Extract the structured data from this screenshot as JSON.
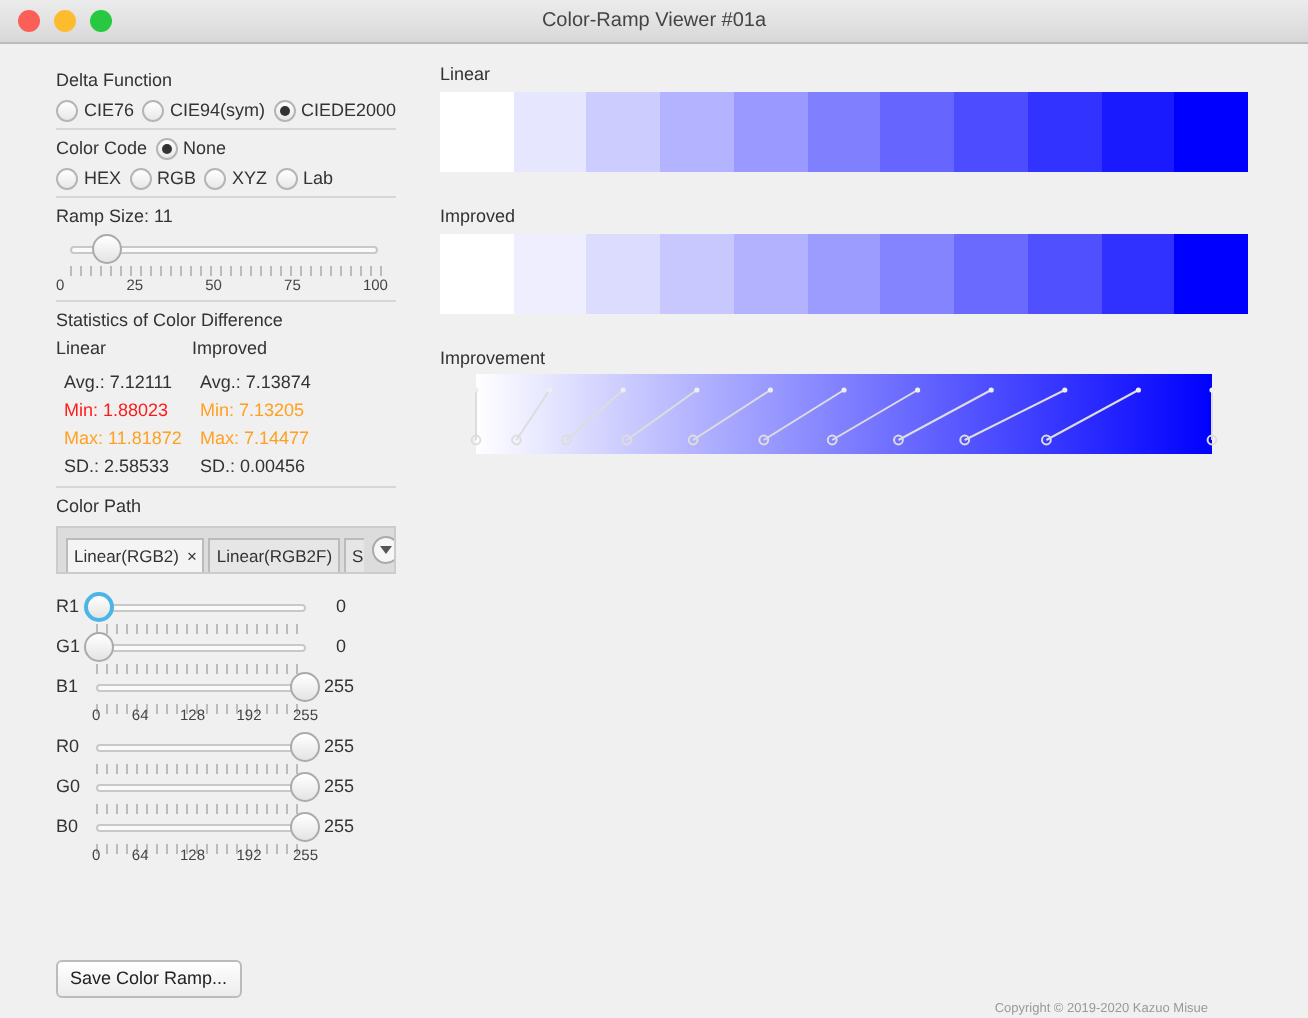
{
  "window": {
    "title": "Color-Ramp Viewer #01a"
  },
  "delta_function": {
    "label": "Delta Function",
    "options": [
      {
        "label": "CIE76",
        "selected": false
      },
      {
        "label": "CIE94(sym)",
        "selected": false
      },
      {
        "label": "CIEDE2000",
        "selected": true
      }
    ]
  },
  "color_code": {
    "label": "Color Code",
    "options": [
      {
        "label": "None",
        "selected": true
      },
      {
        "label": "HEX",
        "selected": false
      },
      {
        "label": "RGB",
        "selected": false
      },
      {
        "label": "XYZ",
        "selected": false
      },
      {
        "label": "Lab",
        "selected": false
      }
    ]
  },
  "ramp_size": {
    "label": "Ramp Size: 11",
    "level": 0.11,
    "scale": [
      "0",
      "25",
      "50",
      "75",
      "100"
    ]
  },
  "statistics": {
    "title": "Statistics of Color Difference",
    "columns": [
      {
        "heading": "Linear",
        "rows": [
          {
            "text": "Avg.: 7.12111",
            "color": "#333333"
          },
          {
            "text": "Min: 1.88023",
            "color": "#ff1a1a"
          },
          {
            "text": "Max: 11.81872",
            "color": "#ffa020"
          },
          {
            "text": "SD.: 2.58533",
            "color": "#333333"
          }
        ]
      },
      {
        "heading": "Improved",
        "rows": [
          {
            "text": "Avg.: 7.13874",
            "color": "#333333"
          },
          {
            "text": "Min: 7.13205",
            "color": "#ffa020"
          },
          {
            "text": "Max: 7.14477",
            "color": "#ffa020"
          },
          {
            "text": "SD.: 0.00456",
            "color": "#333333"
          }
        ]
      }
    ]
  },
  "color_path": {
    "label": "Color Path",
    "tabs": [
      {
        "label": "Linear(RGB2)",
        "closable": true,
        "close_mark": "×",
        "selected": true
      },
      {
        "label": "Linear(RGB2F)",
        "closable": false,
        "selected": false
      },
      {
        "label": "S",
        "closable": false,
        "selected": false
      }
    ],
    "sliders": [
      {
        "label": "R1",
        "level": 0,
        "reading": "0",
        "focused": true
      },
      {
        "label": "G1",
        "level": 0,
        "reading": "0",
        "focused": false
      },
      {
        "label": "B1",
        "level": 1,
        "reading": "255",
        "focused": false,
        "scale": [
          "0",
          "64",
          "128",
          "192",
          "255"
        ]
      },
      {
        "label": "R0",
        "level": 1,
        "reading": "255",
        "focused": false
      },
      {
        "label": "G0",
        "level": 1,
        "reading": "255",
        "focused": false
      },
      {
        "label": "B0",
        "level": 1,
        "reading": "255",
        "focused": false,
        "scale": [
          "0",
          "64",
          "128",
          "192",
          "255"
        ]
      }
    ]
  },
  "ramps": [
    {
      "title": "Linear",
      "swatches": [
        {
          "color": "#ffffff"
        },
        {
          "color": "#e6e6ff"
        },
        {
          "color": "#ccccff"
        },
        {
          "color": "#b3b3ff"
        },
        {
          "color": "#9999ff"
        },
        {
          "color": "#8080ff"
        },
        {
          "color": "#6666ff"
        },
        {
          "color": "#4d4dff"
        },
        {
          "color": "#3333ff"
        },
        {
          "color": "#1a1aff"
        },
        {
          "color": "#0000ff"
        }
      ]
    },
    {
      "title": "Improved",
      "swatches": [
        {
          "color": "#ffffff"
        },
        {
          "color": "#eeeeff"
        },
        {
          "color": "#dcdcff"
        },
        {
          "color": "#c8c8ff"
        },
        {
          "color": "#b2b2ff"
        },
        {
          "color": "#9c9cff"
        },
        {
          "color": "#8484ff"
        },
        {
          "color": "#6a6aff"
        },
        {
          "color": "#5050ff"
        },
        {
          "color": "#3030ff"
        },
        {
          "color": "#0000ff"
        }
      ]
    }
  ],
  "improvement": {
    "title": "Improvement"
  },
  "buttons": [
    "Save Color Ramp..."
  ],
  "copyright": "Copyright © 2019-2020 Kazuo Misue"
}
